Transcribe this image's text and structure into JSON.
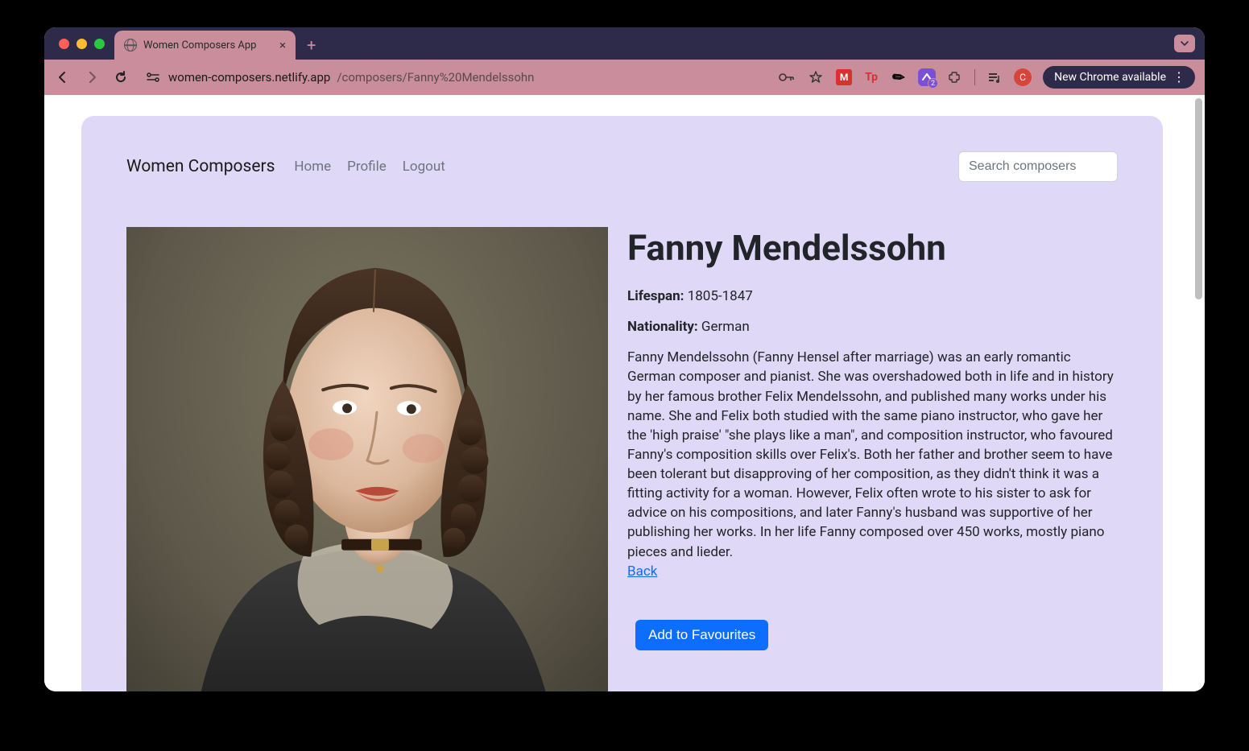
{
  "browser": {
    "tab_title": "Women Composers App",
    "url_host": "women-composers.netlify.app",
    "url_path": "/composers/Fanny%20Mendelssohn",
    "update_label": "New Chrome available",
    "avatar_initial": "C",
    "ext_badge": "2"
  },
  "nav": {
    "brand": "Women Composers",
    "links": [
      "Home",
      "Profile",
      "Logout"
    ],
    "search_placeholder": "Search composers"
  },
  "composer": {
    "name": "Fanny Mendelssohn",
    "lifespan_label": "Lifespan:",
    "lifespan_value": "1805-1847",
    "nationality_label": "Nationality:",
    "nationality_value": "German",
    "bio": "Fanny Mendelssohn (Fanny Hensel after marriage) was an early romantic German composer and pianist. She was overshadowed both in life and in history by her famous brother Felix Mendelssohn, and published many works under his name. She and Felix both studied with the same piano instructor, who gave her the 'high praise' \"she plays like a man\", and composition instructor, who favoured Fanny's composition skills over Felix's. Both her father and brother seem to have been tolerant but disapproving of her composition, as they didn't think it was a fitting activity for a woman. However, Felix often wrote to his sister to ask for advice on his compositions, and later Fanny's husband was supportive of her publishing her works. In her life Fanny composed over 450 works, mostly piano pieces and lieder.",
    "back_label": "Back",
    "fav_button": "Add to Favourites"
  }
}
